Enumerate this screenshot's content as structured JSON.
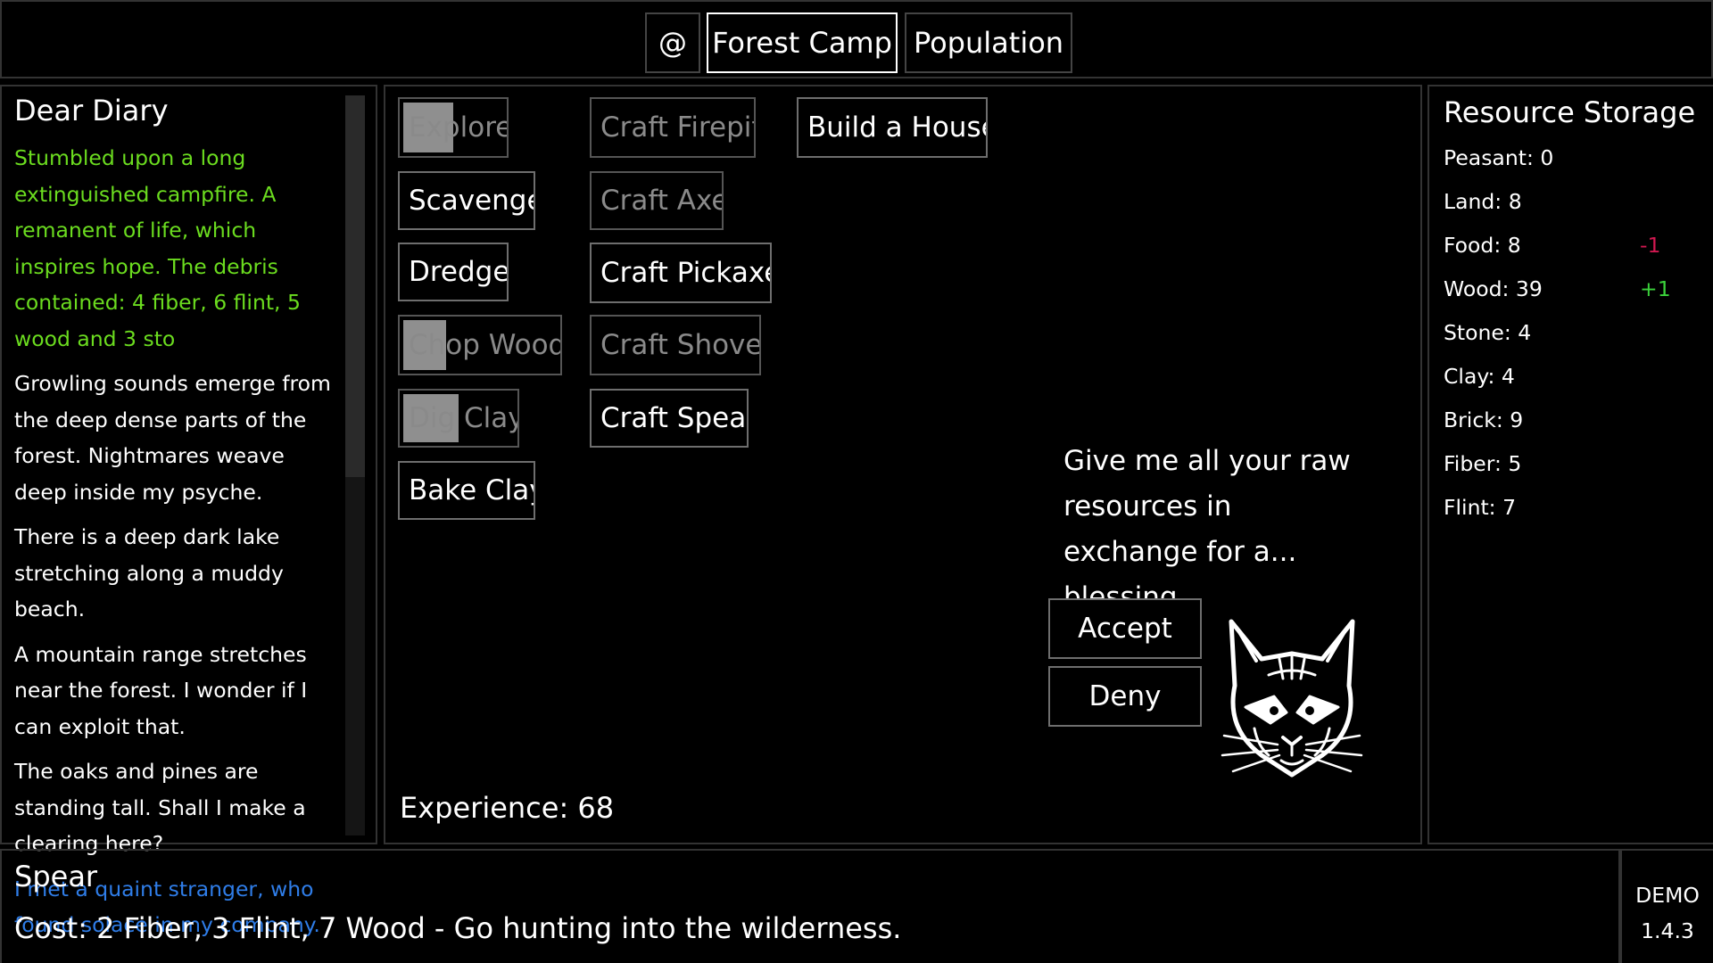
{
  "tabs": [
    {
      "label": "@"
    },
    {
      "label": "Forest Camp",
      "active": true
    },
    {
      "label": "Population"
    }
  ],
  "diary": {
    "title": "Dear Diary",
    "entries": [
      {
        "text": "Stumbled upon a long extinguished campfire. A remanent of life, which inspires hope. The debris contained: 4 fiber, 6 flint, 5 wood and 3 sto",
        "color": "#6bdc1f"
      },
      {
        "text": "Growling sounds emerge from the deep dense parts of the forest. Nightmares weave deep inside my psyche.",
        "color": "#ffffff"
      },
      {
        "text": "There is a deep dark lake stretching along a muddy beach.",
        "color": "#ffffff"
      },
      {
        "text": "A mountain range stretches near the forest. I wonder if I can exploit that.",
        "color": "#ffffff"
      },
      {
        "text": "The oaks and pines are standing tall. Shall I make a clearing here?",
        "color": "#ffffff"
      },
      {
        "text": "I met a quaint stranger, who found solace in my company.",
        "color": "#2f7de8"
      }
    ]
  },
  "actions": {
    "explore": "Explore",
    "scavenge": "Scavenge",
    "dredge": "Dredge",
    "chop_wood": "Chop Wood",
    "dig_clay": "Dig Clay",
    "bake_clay": "Bake Clay",
    "craft_firepit": "Craft Firepit",
    "craft_axe": "Craft Axe",
    "craft_pickaxe": "Craft Pickaxe",
    "craft_shovel": "Craft Shovel",
    "craft_spear": "Craft Spear",
    "build_house": "Build a House",
    "cooldowns": {
      "explore": 0.5,
      "chop_wood": 0.28,
      "dig_clay": 0.5
    }
  },
  "experience": "Experience: 68",
  "offer": {
    "text": "Give me all your raw resources in exchange for a... blessing.",
    "accept": "Accept",
    "deny": "Deny"
  },
  "resources": {
    "title": "Resource Storage",
    "items": [
      {
        "label": "Peasant: 0"
      },
      {
        "label": "Land: 8"
      },
      {
        "label": "Food: 8",
        "delta": "-1",
        "delta_color": "#d01850"
      },
      {
        "label": "Wood: 39",
        "delta": "+1",
        "delta_color": "#3bd23b"
      },
      {
        "label": "Stone: 4"
      },
      {
        "label": "Clay: 4"
      },
      {
        "label": "Brick: 9"
      },
      {
        "label": "Fiber: 5"
      },
      {
        "label": "Flint: 7"
      }
    ]
  },
  "info": {
    "title": "Spear",
    "description": "Cost: 2 Fiber, 3 Flint, 7 Wood - Go hunting into the wilderness."
  },
  "version": {
    "label": "DEMO",
    "number": "1.4.3"
  }
}
